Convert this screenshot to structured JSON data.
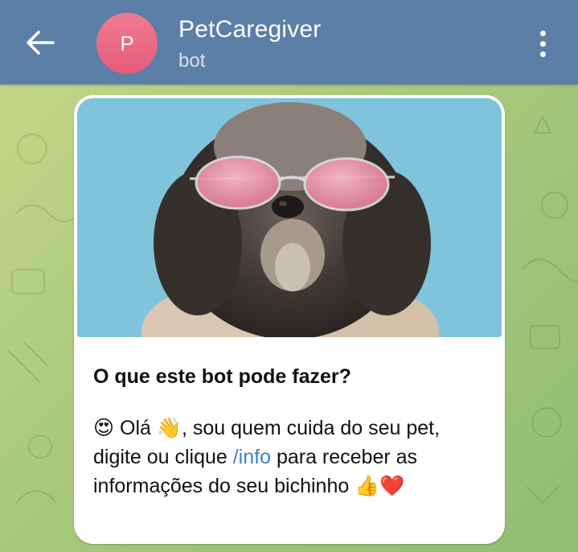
{
  "header": {
    "avatar_letter": "P",
    "title": "PetCaregiver",
    "subtitle": "bot",
    "back_icon": "arrow-left-icon",
    "menu_icon": "more-vertical-icon"
  },
  "card": {
    "image": "dog-with-pink-sunglasses",
    "heading": "O que este bot pode fazer?",
    "line_part1": "😍 Olá 👋, sou quem cuida do seu pet, digite ou clique ",
    "command": "/info",
    "line_part2": " para receber as informações do seu bichinho 👍❤️"
  },
  "colors": {
    "header_bg": "#5b7fa6",
    "avatar_bg": "#e86a85",
    "link": "#3b82c4",
    "card_bg": "#ffffff"
  }
}
